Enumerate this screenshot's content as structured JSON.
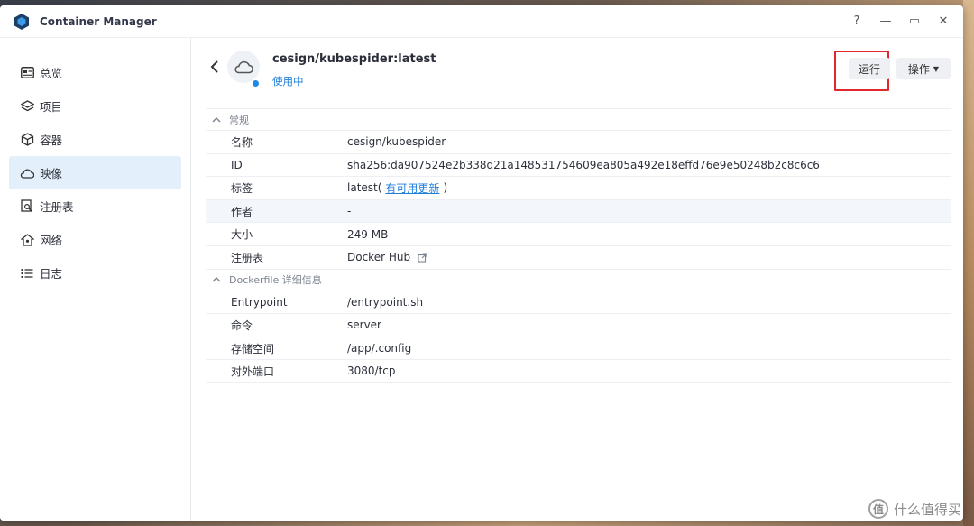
{
  "app": {
    "title": "Container Manager"
  },
  "window_controls": {
    "help": "?",
    "minimize": "—",
    "maximize": "▭",
    "close": "✕"
  },
  "sidebar": {
    "items": [
      {
        "label": "总览",
        "icon": "overview-icon"
      },
      {
        "label": "项目",
        "icon": "layers-icon"
      },
      {
        "label": "容器",
        "icon": "cube-icon"
      },
      {
        "label": "映像",
        "icon": "cloud-icon",
        "active": true
      },
      {
        "label": "注册表",
        "icon": "registry-search-icon"
      },
      {
        "label": "网络",
        "icon": "network-icon"
      },
      {
        "label": "日志",
        "icon": "list-icon"
      }
    ]
  },
  "header": {
    "image_name": "cesign/kubespider:latest",
    "status": "使用中",
    "run_label": "运行",
    "ops_label": "操作"
  },
  "sections": {
    "general": {
      "title": "常规",
      "rows": {
        "name": {
          "k": "名称",
          "v": "cesign/kubespider"
        },
        "id": {
          "k": "ID",
          "v": "sha256:da907524e2b338d21a148531754609ea805a492e18effd76e9e50248b2c8c6c6"
        },
        "tag": {
          "k": "标签",
          "v": "latest(",
          "link": "有可用更新",
          "v_end": ")"
        },
        "author": {
          "k": "作者",
          "v": "-"
        },
        "size": {
          "k": "大小",
          "v": "249 MB"
        },
        "registry": {
          "k": "注册表",
          "v": "Docker Hub"
        }
      }
    },
    "dockerfile": {
      "title": "Dockerfile 详细信息",
      "rows": {
        "entrypoint": {
          "k": "Entrypoint",
          "v": "/entrypoint.sh"
        },
        "command": {
          "k": "命令",
          "v": "server"
        },
        "storage": {
          "k": "存储空间",
          "v": "/app/.config"
        },
        "ports": {
          "k": "对外端口",
          "v": "3080/tcp"
        }
      }
    }
  },
  "watermark": {
    "badge": "值",
    "text": "什么值得买"
  },
  "colors": {
    "accent": "#1e7ed8",
    "active_nav": "#e3effa",
    "highlight_box": "#e0282e"
  }
}
